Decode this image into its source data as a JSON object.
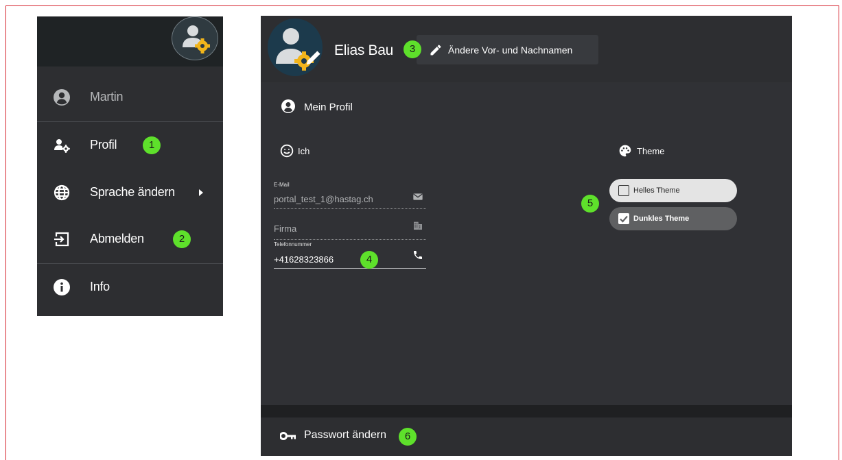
{
  "menu": {
    "user": {
      "label": "Martin",
      "icon": "account-circle-icon"
    },
    "items": [
      {
        "label": "Profil",
        "icon": "user-gear-icon",
        "badge": "1"
      },
      {
        "label": "Sprache ändern",
        "icon": "globe-icon"
      },
      {
        "label": "Abmelden",
        "icon": "logout-icon",
        "badge": "2"
      },
      {
        "label": "Info",
        "icon": "info-icon"
      }
    ]
  },
  "profile": {
    "name": "Elias Bau",
    "rename_badge": "3",
    "rename_label": "Ändere Vor- und Nachnamen",
    "card_title": "Mein Profil",
    "section_me": "Ich",
    "fields": {
      "email": {
        "label": "E-Mail",
        "value": "portal_test_1@hastag.ch"
      },
      "company": {
        "value": "Firma"
      },
      "phone": {
        "label": "Telefonnummer",
        "value": "+41628323866",
        "badge": "4"
      }
    },
    "section_theme": "Theme",
    "theme_badge": "5",
    "themes": [
      {
        "label": "Helles Theme",
        "checked": false
      },
      {
        "label": "Dunkles Theme",
        "checked": true
      }
    ],
    "password": {
      "label": "Passwort ändern",
      "badge": "6"
    }
  },
  "colors": {
    "badge": "#5ee02b",
    "frame_border": "#d4202a",
    "panel": "#2d2e31",
    "gear_accent": "#f2b51b"
  }
}
